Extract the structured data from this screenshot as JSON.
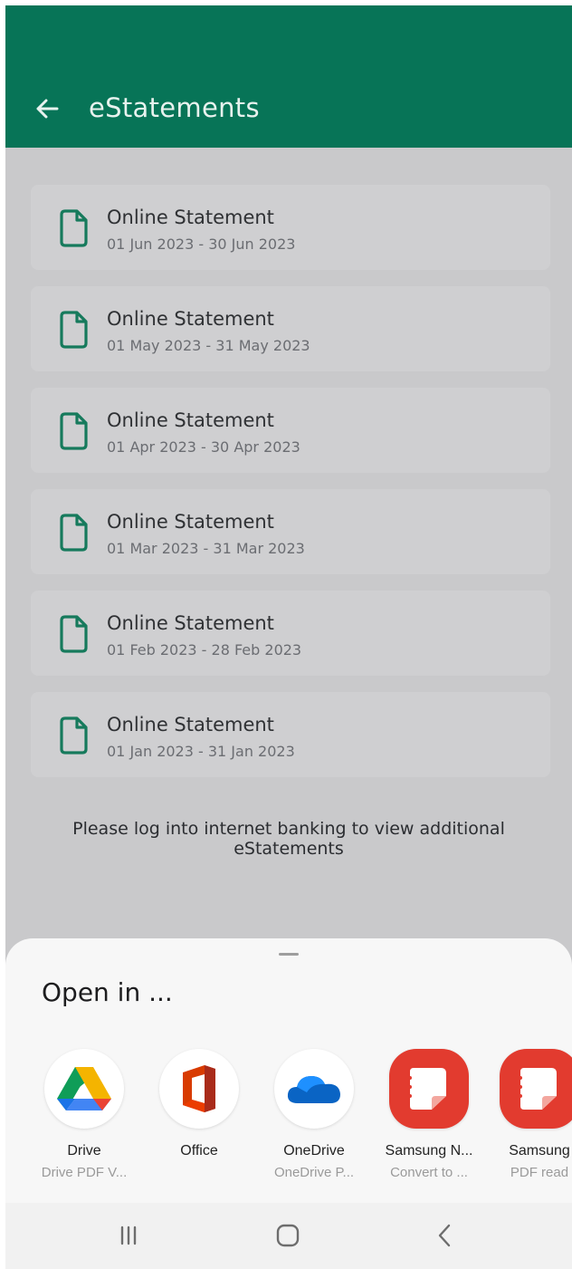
{
  "header": {
    "title": "eStatements",
    "back_icon": "arrow-left-icon",
    "bg_color": "#077457"
  },
  "statements": [
    {
      "name": "Online Statement",
      "range": "01 Jun 2023 - 30 Jun 2023"
    },
    {
      "name": "Online Statement",
      "range": "01 May 2023 - 31 May 2023"
    },
    {
      "name": "Online Statement",
      "range": "01 Apr 2023 - 30 Apr 2023"
    },
    {
      "name": "Online Statement",
      "range": "01 Mar 2023 - 31 Mar 2023"
    },
    {
      "name": "Online Statement",
      "range": "01 Feb 2023 - 28 Feb 2023"
    },
    {
      "name": "Online Statement",
      "range": "01 Jan 2023 - 31 Jan 2023"
    }
  ],
  "note": "Please log into internet banking to view additional eStatements",
  "sheet": {
    "title": "Open in ...",
    "apps": [
      {
        "label": "Drive",
        "sub": "Drive PDF V...",
        "icon": "google-drive-icon"
      },
      {
        "label": "Office",
        "sub": "",
        "icon": "microsoft-office-icon"
      },
      {
        "label": "OneDrive",
        "sub": "OneDrive P...",
        "icon": "onedrive-icon"
      },
      {
        "label": "Samsung N...",
        "sub": "Convert to ...",
        "icon": "samsung-notes-icon"
      },
      {
        "label": "Samsung",
        "sub": "PDF read",
        "icon": "samsung-notes-icon"
      }
    ]
  },
  "navbar": {
    "recents_icon": "recents-icon",
    "home_icon": "home-icon",
    "back_icon": "nav-back-icon"
  },
  "colors": {
    "accent": "#077457",
    "doc_icon": "#167a5c",
    "samsung_red": "#e23b2f"
  }
}
